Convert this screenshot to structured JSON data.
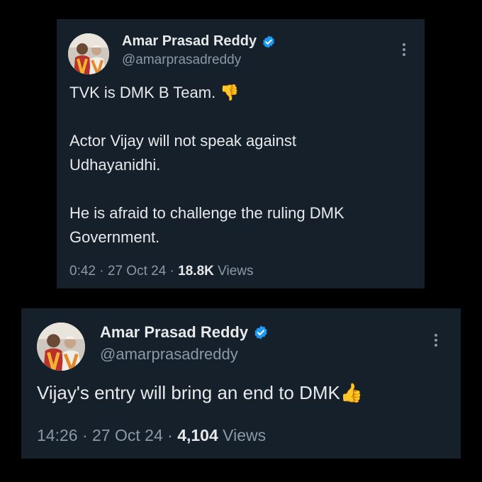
{
  "tweets": [
    {
      "author_name": "Amar Prasad Reddy",
      "handle": "@amarprasadreddy",
      "verified": true,
      "text_lines": [
        "TVK is DMK B Team. 👎",
        "Actor Vijay will not speak against",
        "Udhayanidhi.",
        "He is afraid to challenge the ruling DMK",
        "Government."
      ],
      "time": "0:42",
      "date": "27 Oct 24",
      "views_count": "18.8K",
      "views_label": "Views"
    },
    {
      "author_name": "Amar Prasad Reddy",
      "handle": "@amarprasadreddy",
      "verified": true,
      "text_lines": [
        "Vijay's entry will bring an end to DMK👍"
      ],
      "time": "14:26",
      "date": "27 Oct 24",
      "views_count": "4,104",
      "views_label": "Views"
    }
  ],
  "colors": {
    "background": "#000000",
    "card": "#15202b",
    "text": "#e7e9ea",
    "muted": "#8b98a5",
    "verified": "#1d9bf0"
  },
  "icons": [
    "verified-badge-icon",
    "more-options-icon"
  ]
}
